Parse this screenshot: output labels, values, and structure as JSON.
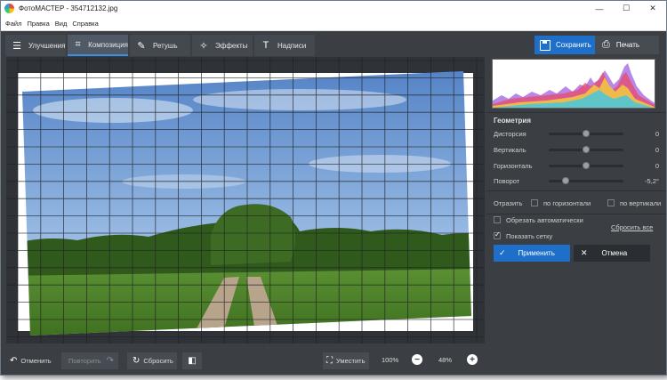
{
  "window": {
    "title": "ФотоМАСТЕР - 354712132.jpg",
    "controls": [
      "—",
      "☐",
      "✕"
    ]
  },
  "menu": [
    "Файл",
    "Правка",
    "Вид",
    "Справка"
  ],
  "tabs": [
    {
      "label": "Улучшения",
      "icon": "sliders-icon",
      "glyph": "☰",
      "active": false
    },
    {
      "label": "Композиция",
      "icon": "crop-icon",
      "glyph": "⌗",
      "active": true
    },
    {
      "label": "Ретушь",
      "icon": "brush-icon",
      "glyph": "✎",
      "active": false
    },
    {
      "label": "Эффекты",
      "icon": "wand-icon",
      "glyph": "✧",
      "active": false
    },
    {
      "label": "Надписи",
      "icon": "text-icon",
      "glyph": "T",
      "active": false
    }
  ],
  "actions": {
    "save_label": "Сохранить",
    "print_label": "Печать",
    "print_glyph": "⎙"
  },
  "geometry": {
    "heading": "Геометрия",
    "sliders": [
      {
        "label": "Дисторсия",
        "value": "0",
        "position": 0.5
      },
      {
        "label": "Вертикаль",
        "value": "0",
        "position": 0.5
      },
      {
        "label": "Горизонталь",
        "value": "0",
        "position": 0.5
      },
      {
        "label": "Поворот",
        "value": "-5,2°",
        "position": 0.23
      }
    ],
    "reflect_label": "Отразить",
    "flip_horizontal": {
      "label": "по горизонтали",
      "checked": false
    },
    "flip_vertical": {
      "label": "по вертикали",
      "checked": false
    },
    "auto_crop": {
      "label": "Обрезать автоматически",
      "checked": false
    },
    "show_grid": {
      "label": "Показать сетку",
      "checked": true
    },
    "reset_all": "Сбросить все",
    "apply_label": "Применить",
    "apply_glyph": "✓",
    "cancel_label": "Отмена",
    "cancel_glyph": "✕"
  },
  "bottom": {
    "undo_label": "Отменить",
    "undo_glyph": "↶",
    "redo_label": "Повторить",
    "redo_glyph": "↷",
    "reset_label": "Сбросить",
    "reset_glyph": "↻",
    "compare_glyph": "◧",
    "fit_label": "Уместить",
    "fit_glyph": "⛶",
    "zoom_100": "100%",
    "zoom_minus": "−",
    "zoom_value": "48%",
    "zoom_plus": "+"
  },
  "colors": {
    "accent": "#1e6fc9",
    "panel_bg": "#3b3f44",
    "canvas_bg": "#2f3236"
  }
}
